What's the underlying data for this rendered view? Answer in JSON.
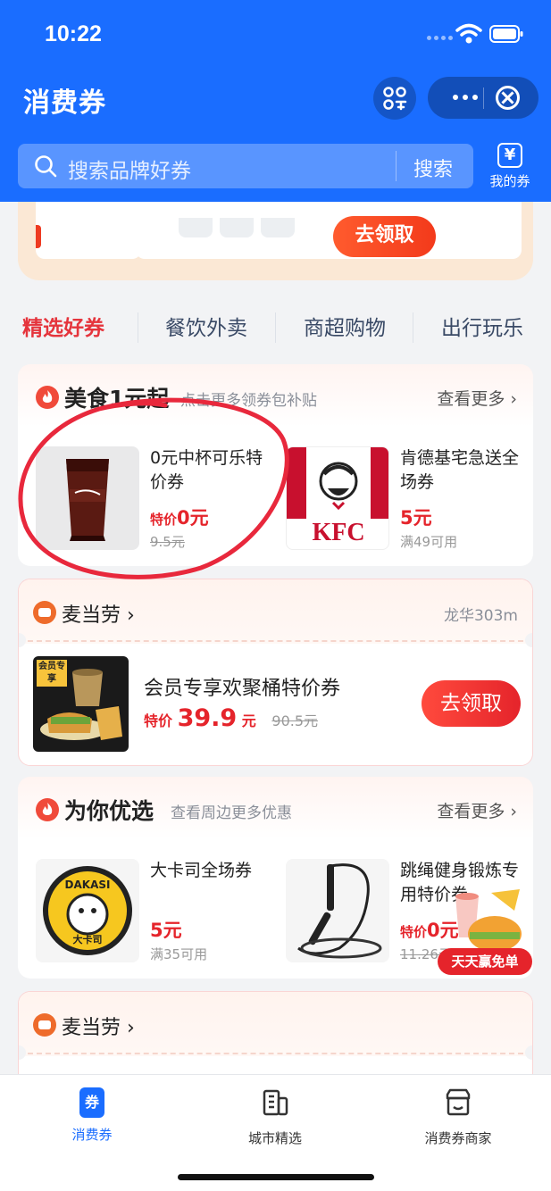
{
  "status_bar": {
    "time": "10:22"
  },
  "header": {
    "title": "消费券",
    "search_placeholder": "搜索品牌好券",
    "search_button": "搜索",
    "my_coupon_icon": "¥",
    "my_coupon_label": "我的券"
  },
  "banner": {
    "grab_label": "去领取"
  },
  "tabs": [
    {
      "label": "精选好券",
      "active": true
    },
    {
      "label": "餐饮外卖",
      "active": false
    },
    {
      "label": "商超购物",
      "active": false
    },
    {
      "label": "出行玩乐",
      "active": false
    }
  ],
  "food_section": {
    "title": "美食1元起",
    "subtitle": "点击更多领券包补贴",
    "see_more": "查看更多 ›",
    "items": [
      {
        "name": "0元中杯可乐特价券",
        "price_prefix": "特价",
        "price": "0元",
        "original": "9.5元"
      },
      {
        "name": "肯德基宅急送全场券",
        "price_prefix": "",
        "price": "5元",
        "original": "满49可用",
        "logo_text": "KFC"
      }
    ]
  },
  "store_card_1": {
    "store": "麦当劳",
    "distance": "龙华303m",
    "deal_tag": "会员专享",
    "deal_name": "会员专享欢聚桶特价券",
    "price_prefix": "特价",
    "price": "39.9",
    "price_unit": "元",
    "original": "90.5元",
    "button": "去领取"
  },
  "recommend_section": {
    "title": "为你优选",
    "subtitle": "查看周边更多优惠",
    "see_more": "查看更多 ›",
    "items": [
      {
        "name": "大卡司全场券",
        "price_prefix": "",
        "price": "5元",
        "original": "满35可用",
        "logo_text": "DAKASI",
        "logo_sub": "大卡司"
      },
      {
        "name": "跳绳健身锻炼专用特价券",
        "price_prefix": "特价",
        "price": "0元",
        "original": "11.26元"
      }
    ]
  },
  "float_promo": {
    "label": "天天赢免单"
  },
  "store_card_2": {
    "store": "麦当劳"
  },
  "tabbar": [
    {
      "label": "消费券",
      "icon": "coupon-icon",
      "icon_text": "券",
      "active": true
    },
    {
      "label": "城市精选",
      "icon": "building-icon",
      "active": false
    },
    {
      "label": "消费券商家",
      "icon": "store-icon",
      "active": false
    }
  ],
  "colors": {
    "brand_blue": "#1a6dff",
    "accent_red": "#e5242b"
  }
}
